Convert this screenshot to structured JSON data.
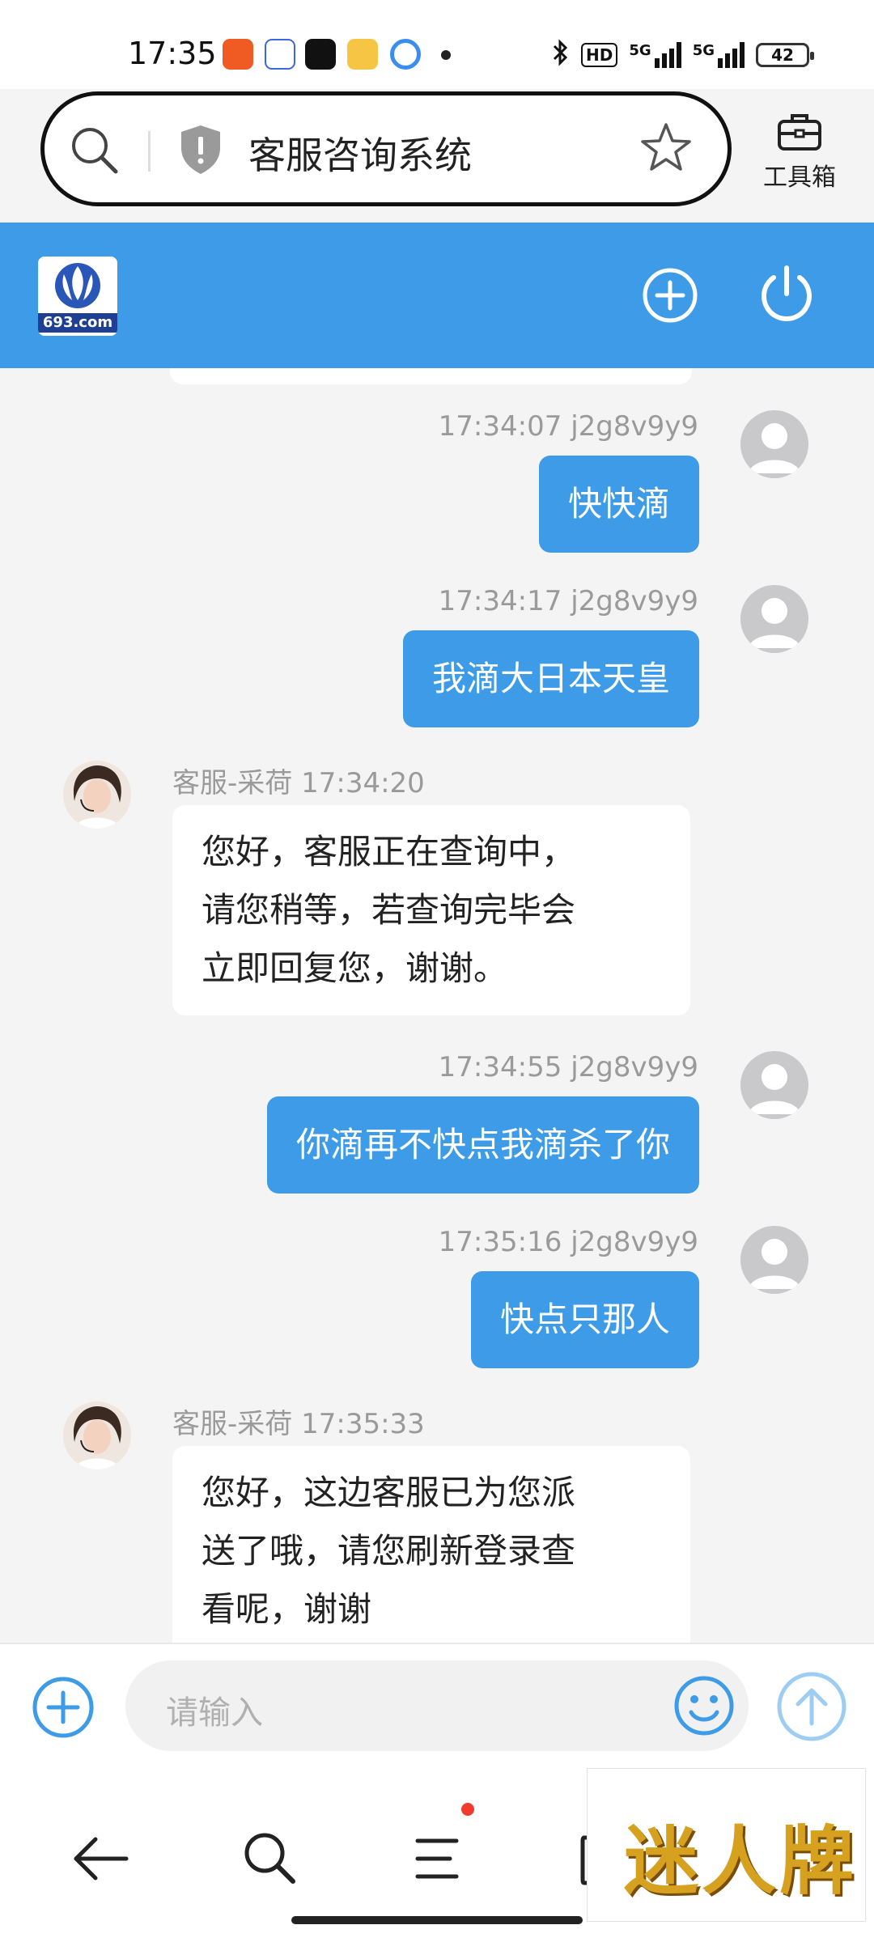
{
  "status_bar": {
    "time": "17:35",
    "hd_label": "HD",
    "network_1": "5G",
    "network_2": "5G",
    "battery": "42",
    "app_icons": [
      "taobao-icon",
      "baidu-icon",
      "douyin-icon",
      "weibo-icon",
      "browser-icon"
    ]
  },
  "browser": {
    "page_title": "客服咨询系统",
    "toolbox_label": "工具箱"
  },
  "header": {
    "logo_text": "693.com",
    "accent_color": "#3d9be7"
  },
  "messages": [
    {
      "from": "user",
      "time": "17:34:07",
      "user": "j2g8v9y9",
      "text": "快快滴"
    },
    {
      "from": "user",
      "time": "17:34:17",
      "user": "j2g8v9y9",
      "text": "我滴大日本天皇"
    },
    {
      "from": "agent",
      "name": "客服-采荷",
      "time": "17:34:20",
      "lines": [
        "您好，客服正在查询中，",
        "请您稍等，若查询完毕会",
        "立即回复您，谢谢。"
      ]
    },
    {
      "from": "user",
      "time": "17:34:55",
      "user": "j2g8v9y9",
      "text": "你滴再不快点我滴杀了你"
    },
    {
      "from": "user",
      "time": "17:35:16",
      "user": "j2g8v9y9",
      "text": "快点只那人"
    },
    {
      "from": "agent",
      "name": "客服-采荷",
      "time": "17:35:33",
      "lines": [
        "您好，这边客服已为您派",
        "送了哦，请您刷新登录查",
        "看呢，谢谢"
      ]
    }
  ],
  "input": {
    "placeholder": "请输入"
  },
  "watermark": {
    "text": "迷人牌"
  }
}
